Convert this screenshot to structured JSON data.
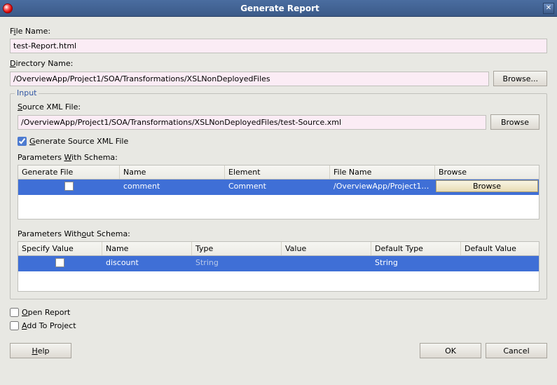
{
  "window": {
    "title": "Generate Report"
  },
  "fileName": {
    "label_pre": "F",
    "label_u": "i",
    "label_post": "le Name:",
    "value": "test-Report.html"
  },
  "dirName": {
    "label_pre": "",
    "label_u": "D",
    "label_post": "irectory Name:",
    "value": "/OverviewApp/Project1/SOA/Transformations/XSLNonDeployedFiles",
    "browse": "Browse..."
  },
  "input": {
    "legend": "Input",
    "sourceXml": {
      "label_pre": "",
      "label_u": "S",
      "label_post": "ource XML File:",
      "value": "/OverviewApp/Project1/SOA/Transformations/XSLNonDeployedFiles/test-Source.xml",
      "browse": "Browse"
    },
    "generateSource": {
      "label_pre": "",
      "label_u": "G",
      "label_post": "enerate Source XML File",
      "checked": true
    },
    "paramsWithSchema": {
      "label_pre": "Parameters ",
      "label_u": "W",
      "label_post": "ith Schema:",
      "headers": [
        "Generate File",
        "Name",
        "Element",
        "File Name",
        "Browse"
      ],
      "row": {
        "name": "comment",
        "element": "Comment",
        "fileName": "/OverviewApp/Project1/...",
        "browse": "Browse"
      }
    },
    "paramsWithoutSchema": {
      "label_pre": "Parameters With",
      "label_u": "o",
      "label_post": "ut Schema:",
      "headers": [
        "Specify Value",
        "Name",
        "Type",
        "Value",
        "Default Type",
        "Default Value"
      ],
      "row": {
        "name": "discount",
        "type": "String",
        "value": "",
        "defaultType": "String",
        "defaultValue": ""
      }
    }
  },
  "openReport": {
    "label_pre": "",
    "label_u": "O",
    "label_post": "pen Report"
  },
  "addToProject": {
    "label_pre": "",
    "label_u": "A",
    "label_post": "dd To Project"
  },
  "footer": {
    "help_u": "H",
    "help_post": "elp",
    "ok": "OK",
    "cancel": "Cancel"
  }
}
